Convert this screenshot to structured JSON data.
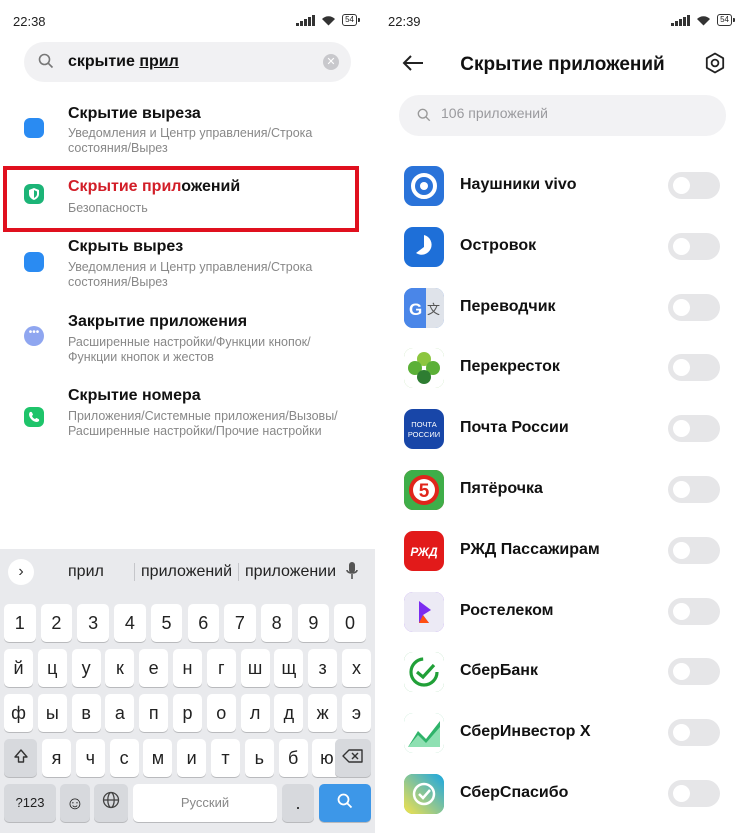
{
  "left_screen": {
    "status": {
      "time": "22:38",
      "battery": "54"
    },
    "search": {
      "query_plain": "скрытие ",
      "query_underlined": "прил",
      "clear_icon": "close-icon"
    },
    "results": [
      {
        "title": "Скрытие выреза",
        "subtitle": "Уведомления и Центр управления/Строка состояния/Вырез",
        "icon": "notch-icon",
        "color": "#2a8bf2",
        "highlighted": false
      },
      {
        "title_match": "Скрытие прил",
        "title_rest": "ожений",
        "subtitle": "Безопасность",
        "icon": "shield-icon",
        "color": "#1cb477",
        "highlighted": true
      },
      {
        "title": "Скрыть вырез",
        "subtitle": "Уведомления и Центр управления/Строка состояния/Вырез",
        "icon": "notch-icon",
        "color": "#2a8bf2",
        "highlighted": false
      },
      {
        "title": "Закрытие приложения",
        "subtitle": "Расширенные настройки/Функции кнопок/Функции кнопок и жестов",
        "icon": "more-icon",
        "color": "#8fa6f0",
        "highlighted": false
      },
      {
        "title": "Скрытие номера",
        "subtitle": "Приложения/Системные приложения/Вызовы/Расширенные настройки/Прочие настройки",
        "icon": "phone-icon",
        "color": "#1ec46a",
        "highlighted": false
      }
    ],
    "keyboard": {
      "suggestions": [
        "прил",
        "приложений",
        "приложении"
      ],
      "number_row": [
        "1",
        "2",
        "3",
        "4",
        "5",
        "6",
        "7",
        "8",
        "9",
        "0"
      ],
      "row1": [
        "й",
        "ц",
        "у",
        "к",
        "е",
        "н",
        "г",
        "ш",
        "щ",
        "з",
        "х"
      ],
      "row2": [
        "ф",
        "ы",
        "в",
        "а",
        "п",
        "р",
        "о",
        "л",
        "д",
        "ж",
        "э"
      ],
      "row3": [
        "я",
        "ч",
        "с",
        "м",
        "и",
        "т",
        "ь",
        "б",
        "ю"
      ],
      "shift_icon": "shift-icon",
      "backspace_icon": "backspace-icon",
      "sym_label": "?123",
      "emoji_label": "☺",
      "lang_icon": "globe-icon",
      "space_label": "Русский",
      "dot_label": ".",
      "search_icon": "search-icon"
    }
  },
  "right_screen": {
    "status": {
      "time": "22:39",
      "battery": "54"
    },
    "title": "Скрытие приложений",
    "search_placeholder": "106 приложений",
    "apps": [
      {
        "name": "Наушники vivo",
        "icon": "vivo-headphones-icon",
        "color": "#2a73d9",
        "hidden": false
      },
      {
        "name": "Островок",
        "icon": "ostrovok-icon",
        "color": "#1e6fd8",
        "hidden": false
      },
      {
        "name": "Переводчик",
        "icon": "translate-icon",
        "color": "#4a86e8",
        "hidden": false
      },
      {
        "name": "Перекресток",
        "icon": "perekrestok-icon",
        "color": "#5bb037",
        "hidden": false
      },
      {
        "name": "Почта России",
        "icon": "russian-post-icon",
        "color": "#1846a8",
        "hidden": false
      },
      {
        "name": "Пятёрочка",
        "icon": "pyaterochka-icon",
        "color": "#e1251b",
        "hidden": false
      },
      {
        "name": "РЖД Пассажирам",
        "icon": "rzd-icon",
        "color": "#e21a1a",
        "hidden": false
      },
      {
        "name": "Ростелеком",
        "icon": "rostelecom-icon",
        "color": "#7b2cf0",
        "hidden": false
      },
      {
        "name": "СберБанк",
        "icon": "sberbank-icon",
        "color": "#21a038",
        "hidden": false
      },
      {
        "name": "СберИнвестор X",
        "icon": "sber-investor-icon",
        "color": "#2fb36a",
        "hidden": false
      },
      {
        "name": "СберСпасибо",
        "icon": "sber-spasibo-icon",
        "color": "#28c36a",
        "hidden": false
      }
    ]
  }
}
